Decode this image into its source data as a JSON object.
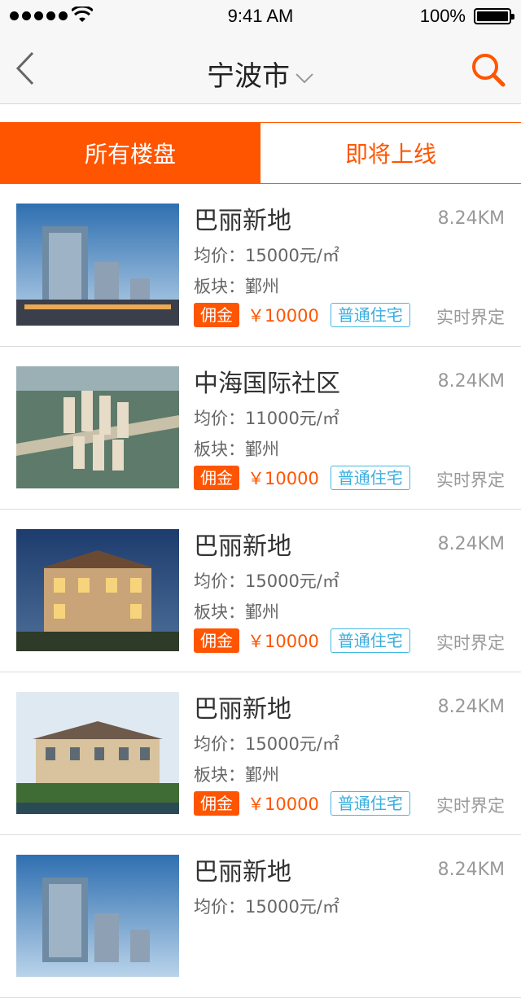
{
  "status_bar": {
    "time": "9:41 AM",
    "battery": "100%"
  },
  "nav": {
    "title": "宁波市",
    "back_icon": "chevron-left-icon",
    "search_icon": "search-icon",
    "accent": "#ff5500"
  },
  "tabs": [
    {
      "label": "所有楼盘",
      "active": true
    },
    {
      "label": "即将上线",
      "active": false
    }
  ],
  "listings": [
    {
      "name": "巴丽新地",
      "distance": "8.24KM",
      "price": "均价：15000元/㎡",
      "area": "板块：鄞州",
      "badge": "佣金",
      "commission": "￥10000",
      "type": "普通住宅",
      "status": "实时界定"
    },
    {
      "name": "中海国际社区",
      "distance": "8.24KM",
      "price": "均价：11000元/㎡",
      "area": "板块：鄞州",
      "badge": "佣金",
      "commission": "￥10000",
      "type": "普通住宅",
      "status": "实时界定"
    },
    {
      "name": "巴丽新地",
      "distance": "8.24KM",
      "price": "均价：15000元/㎡",
      "area": "板块：鄞州",
      "badge": "佣金",
      "commission": "￥10000",
      "type": "普通住宅",
      "status": "实时界定"
    },
    {
      "name": "巴丽新地",
      "distance": "8.24KM",
      "price": "均价：15000元/㎡",
      "area": "板块：鄞州",
      "badge": "佣金",
      "commission": "￥10000",
      "type": "普通住宅",
      "status": "实时界定"
    },
    {
      "name": "巴丽新地",
      "distance": "8.24KM",
      "price": "均价：15000元/㎡",
      "area": "",
      "badge": "",
      "commission": "",
      "type": "",
      "status": ""
    }
  ]
}
